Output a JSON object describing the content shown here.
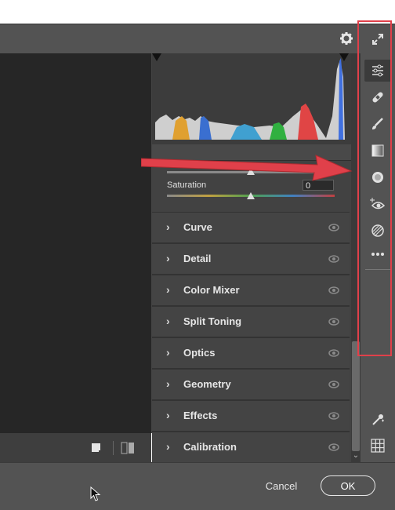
{
  "panel": {
    "saturation_label": "Saturation",
    "saturation_value": "0",
    "sections": [
      {
        "label": "Curve"
      },
      {
        "label": "Detail"
      },
      {
        "label": "Color Mixer"
      },
      {
        "label": "Split Toning"
      },
      {
        "label": "Optics"
      },
      {
        "label": "Geometry"
      },
      {
        "label": "Effects"
      },
      {
        "label": "Calibration"
      }
    ]
  },
  "header": {
    "settings_icon": "gear-icon"
  },
  "toolbar": {
    "tools": [
      "expand-icon",
      "edit-sliders-icon",
      "healing-bandage-icon",
      "brush-icon",
      "gradient-icon",
      "radial-filter-icon",
      "red-eye-icon",
      "presets-icon",
      "more-icon"
    ],
    "bottom_tools": [
      "color-sampler-icon",
      "grid-overlay-icon"
    ]
  },
  "footer": {
    "cancel_label": "Cancel",
    "ok_label": "OK"
  },
  "colors": {
    "annotation_red": "#e0404a",
    "panel_bg": "#424242",
    "toolbar_bg": "#535353"
  }
}
